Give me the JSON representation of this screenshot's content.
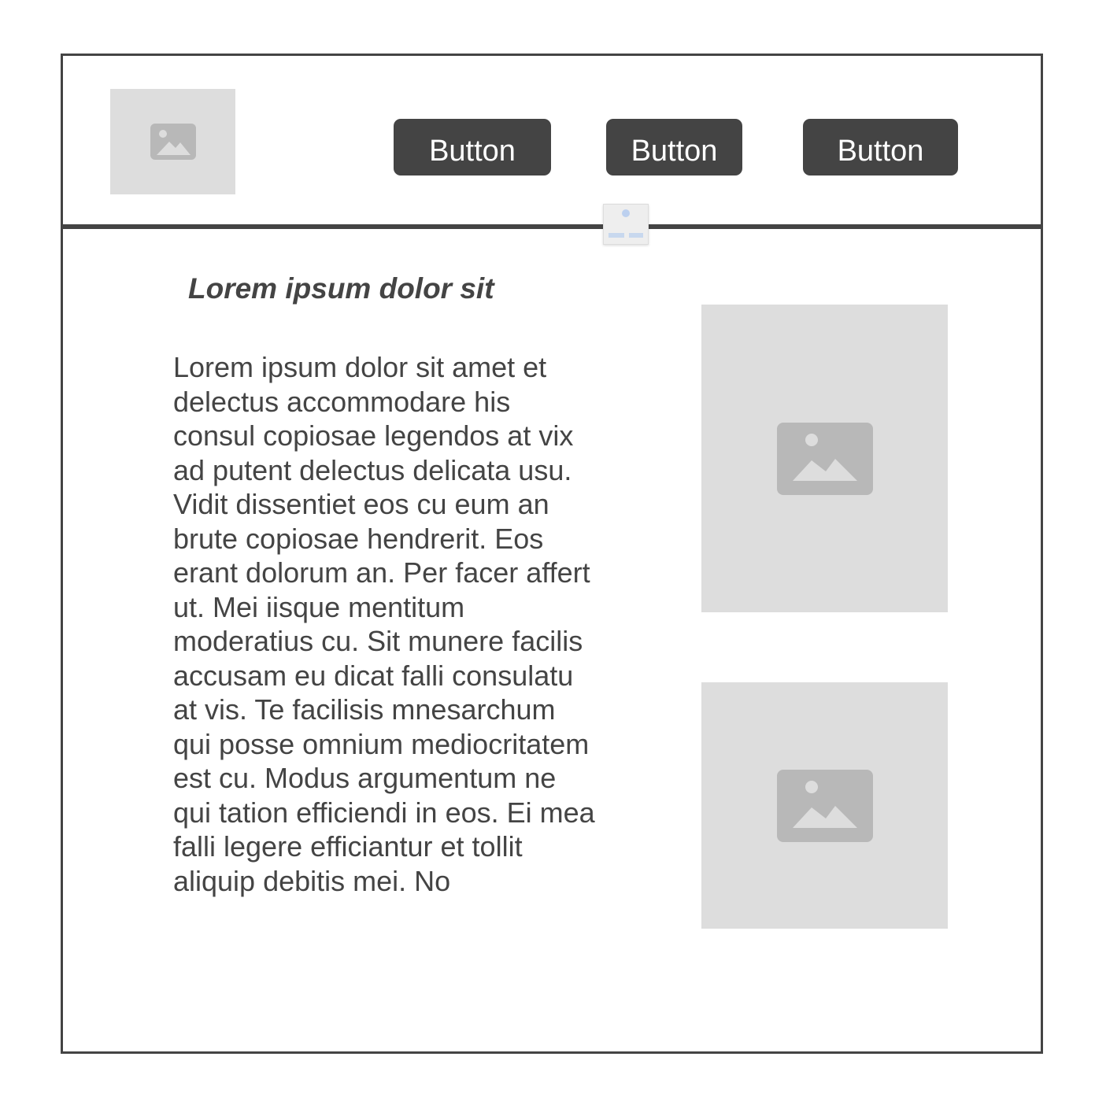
{
  "header": {
    "logo_icon": "image-placeholder-icon",
    "buttons": [
      {
        "label": "Button"
      },
      {
        "label": "Button"
      },
      {
        "label": "Button"
      }
    ]
  },
  "main": {
    "heading": "Lorem ipsum dolor sit",
    "body": "Lorem ipsum dolor sit amet et delectus accommodare his consul copiosae legendos at vix ad putent delectus delicata usu. Vidit dissentiet eos cu eum an brute copiosae hendrerit. Eos erant dolorum an. Per facer affert ut. Mei iisque mentitum moderatius cu. Sit munere facilis accusam eu dicat falli consulatu at vis. Te facilisis mnesarchum qui posse omnium mediocritatem est cu. Modus argumentum ne qui tation efficiendi in eos. Ei mea falli legere efficiantur et tollit aliquip debitis mei. No",
    "images": [
      {
        "icon": "image-placeholder-icon"
      },
      {
        "icon": "image-placeholder-icon"
      }
    ]
  },
  "colors": {
    "frame": "#444444",
    "button_bg": "#444444",
    "button_text": "#ffffff",
    "placeholder_bg": "#dddddd",
    "placeholder_icon": "#b8b8b8"
  }
}
